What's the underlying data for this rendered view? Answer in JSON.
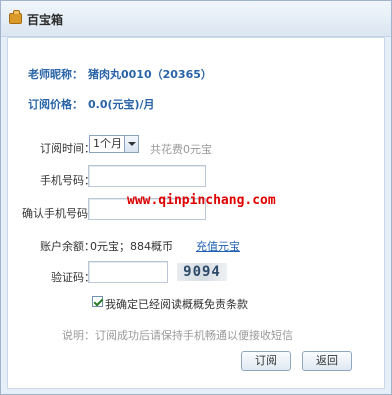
{
  "window": {
    "title": "百宝箱"
  },
  "teacher": {
    "label": "老师昵称：",
    "value": "猪肉丸0010（20365）"
  },
  "price": {
    "label": "订阅价格：",
    "value": "0.0(元宝)/月"
  },
  "subscription_time": {
    "label": "订阅时间：",
    "selected": "1个月",
    "cost_hint": "共花费0元宝"
  },
  "phone": {
    "label": "手机号码：",
    "value": ""
  },
  "confirm_phone": {
    "label": "确认手机号码：",
    "value": ""
  },
  "watermark": "www.qinpinchang.com",
  "balance": {
    "label": "账户余额：",
    "value": "0元宝；884概币",
    "recharge_link": "充值元宝"
  },
  "captcha": {
    "label": "验证码：",
    "value": "",
    "image_text": "9094"
  },
  "agreement": {
    "checked": true,
    "label": "我确定已经阅读概概免责条款"
  },
  "note": "说明：订阅成功后请保持手机畅通以便接收短信",
  "buttons": {
    "subscribe": "订阅",
    "back": "返回"
  },
  "colors": {
    "label_blue": "#2a64a8",
    "link_blue": "#1f5fb4",
    "watermark_red": "#e00000",
    "title_bg": "#dbe6f2"
  }
}
